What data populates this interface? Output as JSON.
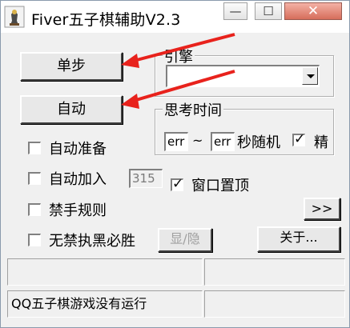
{
  "titlebar": {
    "title": "Fiver五子棋辅助V2.3",
    "minimize_glyph": "—",
    "maximize_glyph": "☐",
    "close_glyph": "✕"
  },
  "buttons": {
    "single_step": "单步",
    "auto": "自动",
    "expand": ">>",
    "show_hide": "显/隐",
    "about": "关于..."
  },
  "engine": {
    "group_label": "引擎",
    "selected_value": ""
  },
  "think_time": {
    "group_label": "思考时间",
    "min_value": "err",
    "separator": "~",
    "max_value": "err",
    "random_label": "秒随机",
    "random_checked": true,
    "precise_label": "精"
  },
  "options": {
    "auto_ready": {
      "label": "自动准备",
      "checked": false
    },
    "auto_join": {
      "label": "自动加入",
      "checked": false,
      "value": "315"
    },
    "window_topmost": {
      "label": "窗口置顶",
      "checked": true
    },
    "forbidden_rules": {
      "label": "禁手规则",
      "checked": false
    },
    "no_forbidden_black_win": {
      "label": "无禁执黑必胜",
      "checked": false
    }
  },
  "status": {
    "top_left": "",
    "top_right": "",
    "message": "QQ五子棋游戏没有运行",
    "bottom_right": ""
  },
  "colors": {
    "annotation_arrow": "#e8221c",
    "window_bg": "#f0f0f0",
    "close_button": "#d66d5b"
  },
  "icons": {
    "app": "chess-piece-icon",
    "check": "checkmark-icon",
    "dropdown": "chevron-down-icon"
  }
}
